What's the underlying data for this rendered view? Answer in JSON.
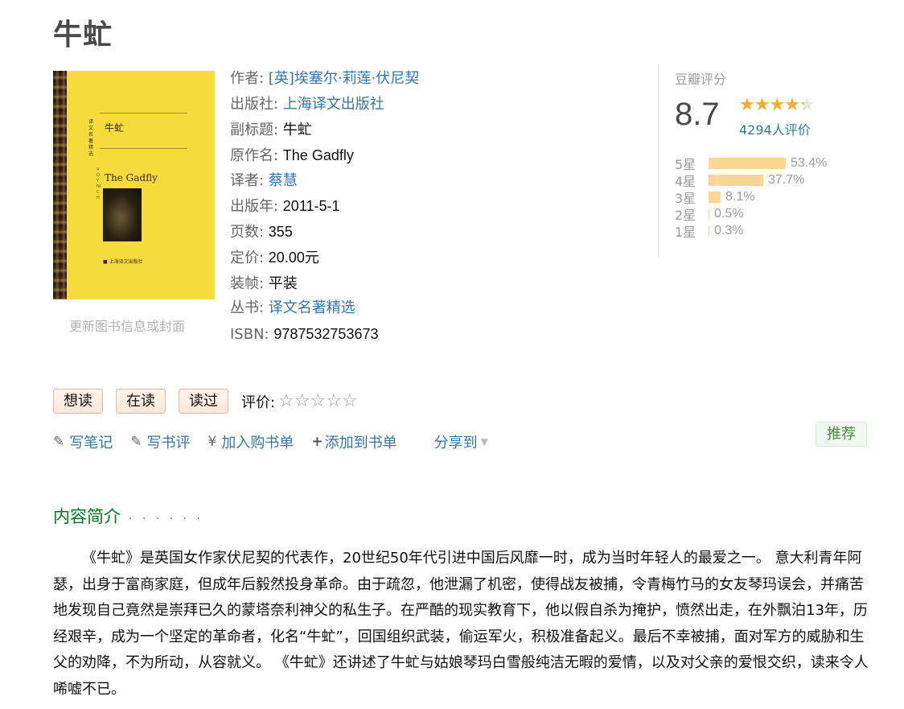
{
  "book": {
    "title": "牛虻"
  },
  "cover": {
    "cn_title": "牛虻",
    "en_title": "The Gadfly",
    "update_link": "更新图书信息或封面"
  },
  "info": [
    {
      "label": "作者: ",
      "value": "[英]埃塞尔·莉莲·伏尼契",
      "link": true
    },
    {
      "label": "出版社: ",
      "value": "上海译文出版社",
      "link": true
    },
    {
      "label": "副标题: ",
      "value": "牛虻",
      "link": false
    },
    {
      "label": "原作名: ",
      "value": "The Gadfly",
      "link": false
    },
    {
      "label": "译者: ",
      "value": "蔡慧",
      "link": true
    },
    {
      "label": "出版年: ",
      "value": "2011-5-1",
      "link": false
    },
    {
      "label": "页数: ",
      "value": "355",
      "link": false
    },
    {
      "label": "定价: ",
      "value": "20.00元",
      "link": false
    },
    {
      "label": "装帧: ",
      "value": "平装",
      "link": false
    },
    {
      "label": "丛书: ",
      "value": "译文名著精选",
      "link": true
    },
    {
      "label": "ISBN: ",
      "value": "9787532753673",
      "link": false
    }
  ],
  "rating": {
    "label": "豆瓣评分",
    "score": "8.7",
    "stars_display": "★★★★★",
    "count": "4294人评价",
    "distribution": [
      {
        "label": "5星",
        "pct": "53.4%",
        "value": 53.4
      },
      {
        "label": "4星",
        "pct": "37.7%",
        "value": 37.7
      },
      {
        "label": "3星",
        "pct": "8.1%",
        "value": 8.1
      },
      {
        "label": "2星",
        "pct": "0.5%",
        "value": 0.5
      },
      {
        "label": "1星",
        "pct": "0.3%",
        "value": 0.3
      }
    ],
    "colors": {
      "star": "#ffac2d",
      "bar": "#ffd596"
    }
  },
  "actions": {
    "want": "想读",
    "reading": "在读",
    "read": "读过",
    "my_rating_label": "评价:",
    "empty_stars": "☆☆☆☆☆"
  },
  "links": {
    "note": "写笔记",
    "review": "写书评",
    "cart": "加入购书单",
    "booklist": "添加到书单",
    "share": "分享到",
    "recommend": "推荐",
    "icons": {
      "note": "pencil-icon",
      "review": "pencil-icon",
      "cart": "yen-icon",
      "booklist": "plus-icon",
      "share": "caret-down-icon"
    }
  },
  "intro": {
    "title": "内容简介",
    "dots": "· · · · · ·",
    "text": "《牛虻》是英国女作家伏尼契的代表作，20世纪50年代引进中国后风靡一时，成为当时年轻人的最爱之一。 意大利青年阿瑟，出身于富商家庭，但成年后毅然投身革命。由于疏忽，他泄漏了机密，使得战友被捕，令青梅竹马的女友琴玛误会，并痛苦地发现自己竟然是崇拜已久的蒙塔奈利神父的私生子。在严酷的现实教育下，他以假自杀为掩护，愤然出走，在外飘泊13年，历经艰辛，成为一个坚定的革命者，化名“牛虻”，回国组织武装，偷运军火，积极准备起义。最后不幸被捕，面对军方的威胁和生父的劝降，不为所动，从容就义。 《牛虻》还讲述了牛虻与姑娘琴玛白雪般纯洁无暇的爱情，以及对父亲的爱恨交织，读来令人唏嘘不已。"
  }
}
